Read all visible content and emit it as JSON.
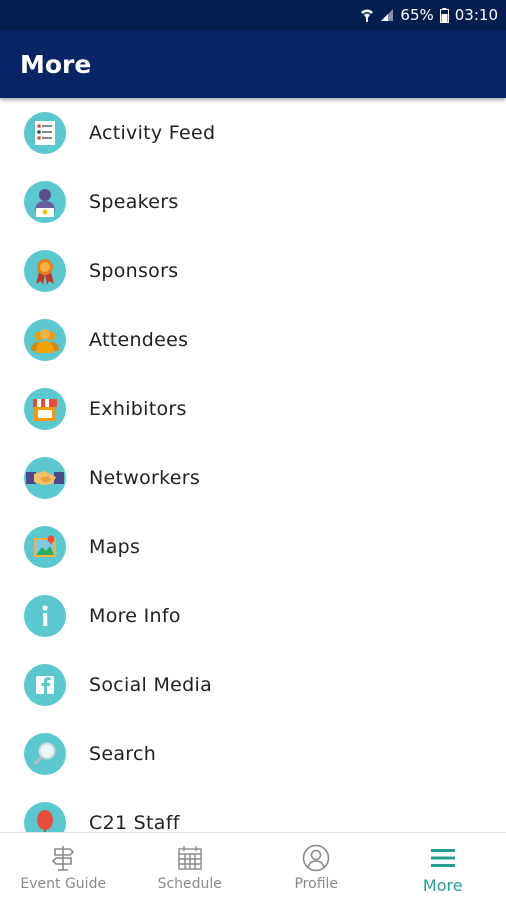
{
  "status_bar": {
    "battery": "65%",
    "time": "03:10",
    "icons": [
      "wifi-icon",
      "signal-icon",
      "battery-icon"
    ]
  },
  "app_bar": {
    "title": "More"
  },
  "menu": {
    "items": [
      {
        "label": "Activity Feed",
        "icon": "activity-feed-icon"
      },
      {
        "label": "Speakers",
        "icon": "speaker-icon"
      },
      {
        "label": "Sponsors",
        "icon": "ribbon-award-icon"
      },
      {
        "label": "Attendees",
        "icon": "attendees-icon"
      },
      {
        "label": "Exhibitors",
        "icon": "storefront-icon"
      },
      {
        "label": "Networkers",
        "icon": "handshake-icon"
      },
      {
        "label": "Maps",
        "icon": "map-icon"
      },
      {
        "label": "More Info",
        "icon": "info-icon"
      },
      {
        "label": "Social Media",
        "icon": "facebook-icon"
      },
      {
        "label": "Search",
        "icon": "magnifier-icon"
      },
      {
        "label": "C21 Staff",
        "icon": "balloon-icon"
      }
    ]
  },
  "bottom_nav": {
    "tabs": [
      {
        "label": "Event Guide",
        "icon": "signpost-icon",
        "active": false
      },
      {
        "label": "Schedule",
        "icon": "calendar-icon",
        "active": false
      },
      {
        "label": "Profile",
        "icon": "profile-icon",
        "active": false
      },
      {
        "label": "More",
        "icon": "menu-icon",
        "active": true
      }
    ]
  },
  "colors": {
    "status_bar": "#041f4f",
    "app_bar": "#062565",
    "icon_circle": "#5bc7cf",
    "active_tab": "#2a9d92",
    "inactive_tab": "#8a8a8a"
  }
}
